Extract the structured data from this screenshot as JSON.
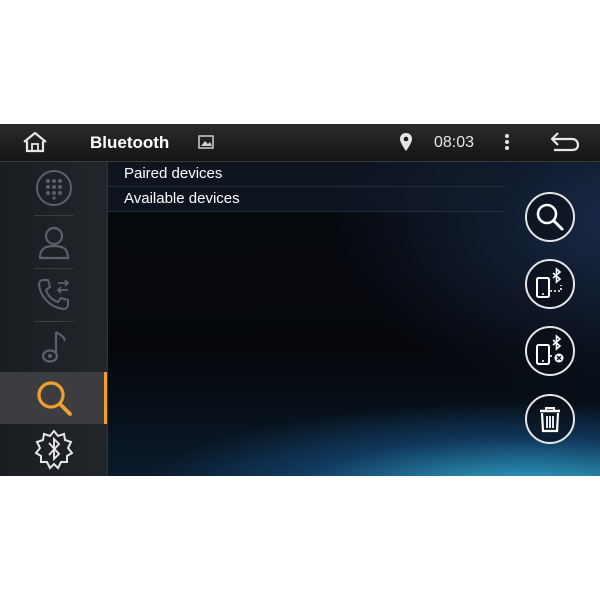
{
  "statusbar": {
    "title": "Bluetooth",
    "time": "08:03",
    "icons": [
      "home-icon",
      "image-icon",
      "location-icon",
      "overflow-menu-icon",
      "back-icon"
    ]
  },
  "sidebar": {
    "items": [
      {
        "icon": "dialpad-icon",
        "selected": false
      },
      {
        "icon": "contacts-icon",
        "selected": false
      },
      {
        "icon": "call-log-icon",
        "selected": false
      },
      {
        "icon": "music-icon",
        "selected": false
      },
      {
        "icon": "search-icon",
        "selected": true
      },
      {
        "icon": "bluetooth-settings-icon",
        "selected": false
      }
    ],
    "accent_color": "#f0a030"
  },
  "list": {
    "rows": [
      "Paired devices",
      "Available devices"
    ]
  },
  "actions": {
    "buttons": [
      "search-icon",
      "phone-bluetooth-connect-icon",
      "phone-bluetooth-disconnect-icon",
      "trash-icon"
    ]
  }
}
